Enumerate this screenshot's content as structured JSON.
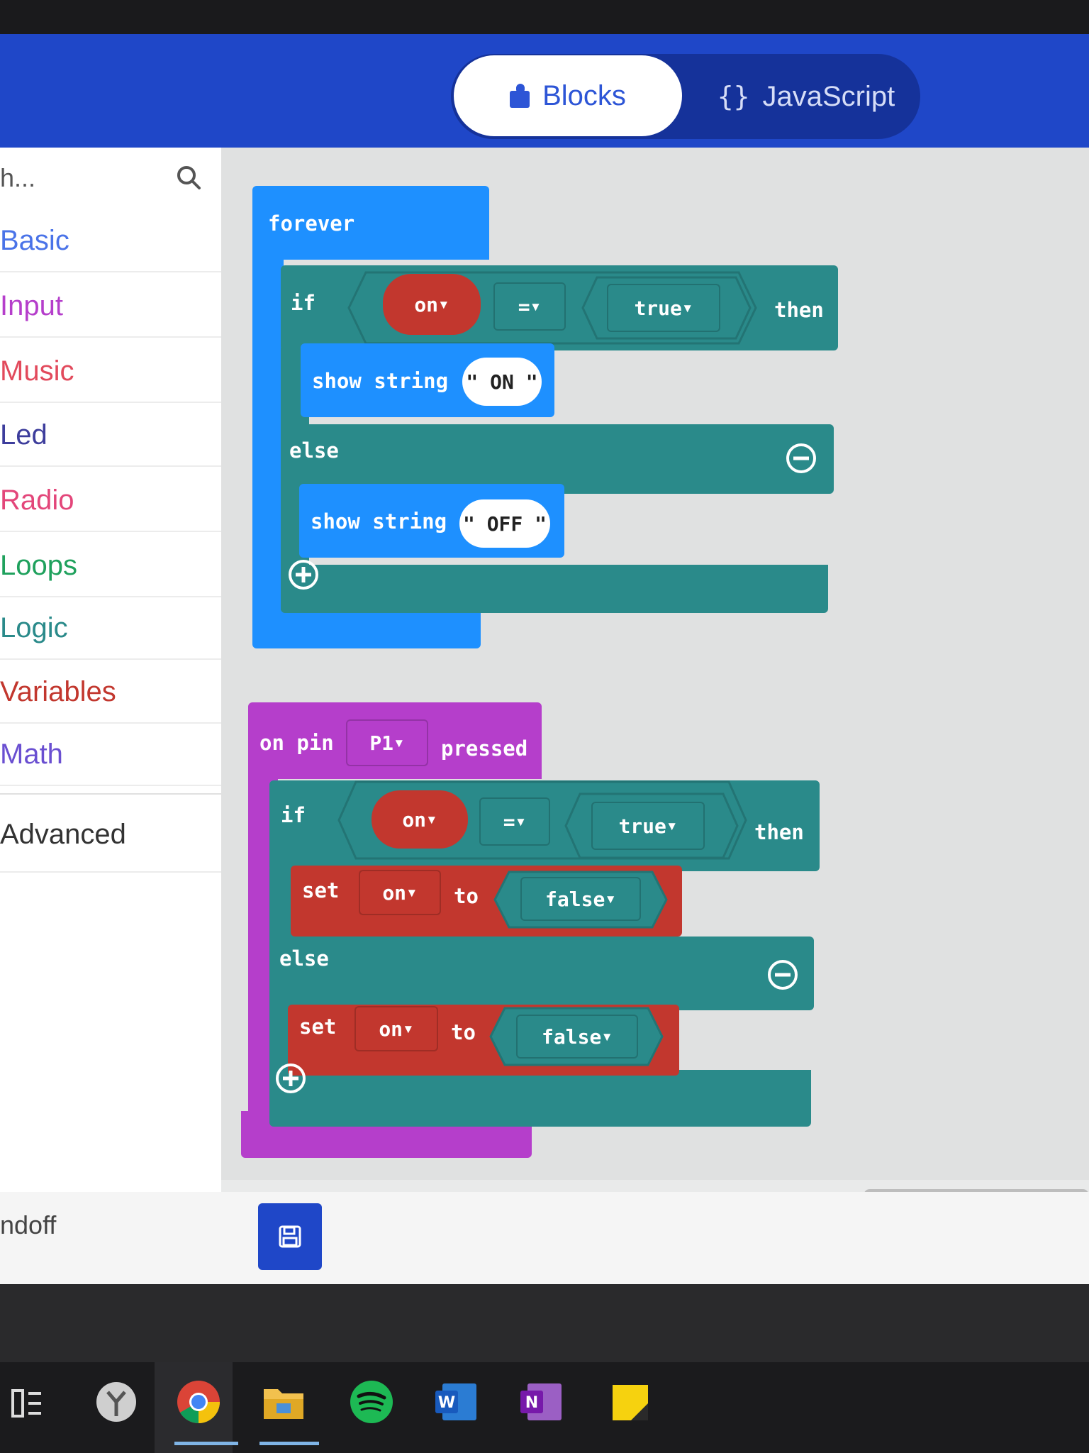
{
  "header": {
    "tab_blocks": "Blocks",
    "tab_javascript": "JavaScript",
    "tab_javascript_icon": "{}"
  },
  "sidebar": {
    "search_placeholder": "h...",
    "categories": [
      {
        "label": "Basic",
        "color": "#1e90ff"
      },
      {
        "label": "Input",
        "color": "#b53ecb"
      },
      {
        "label": "Music",
        "color": "#e24a5c"
      },
      {
        "label": "Led",
        "color": "#3d3d9c"
      },
      {
        "label": "Radio",
        "color": "#e3467a"
      },
      {
        "label": "Loops",
        "color": "#1fa15d"
      },
      {
        "label": "Logic",
        "color": "#2a8a8a"
      },
      {
        "label": "Variables",
        "color": "#c2372e"
      },
      {
        "label": "Math",
        "color": "#6a4fd1"
      }
    ],
    "advanced": "Advanced"
  },
  "blocks": {
    "forever": {
      "label": "forever",
      "if_label": "if",
      "cond_var": "on",
      "cond_op": "=",
      "cond_value": "true",
      "then_label": "then",
      "show1_label": "show string",
      "show1_value": "ON",
      "else_label": "else",
      "show2_label": "show string",
      "show2_value": "OFF"
    },
    "onpin": {
      "label_pre": "on pin",
      "pin": "P1",
      "label_post": "pressed",
      "if_label": "if",
      "cond_var": "on",
      "cond_op": "=",
      "cond_value": "true",
      "then_label": "then",
      "set1_label": "set",
      "set1_var": "on",
      "set1_to": "to",
      "set1_value": "false",
      "else_label": "else",
      "set2_label": "set",
      "set2_var": "on",
      "set2_to": "to",
      "set2_value": "false"
    }
  },
  "footer": {
    "project_name": "ndoff"
  },
  "colors": {
    "header": "#1f47c8",
    "basic": "#1e90ff",
    "logic": "#2a8a8a",
    "variables": "#c2372e",
    "input": "#b53ecb"
  },
  "taskbar": {
    "icons": [
      "task-view-icon",
      "clock-app-icon",
      "chrome-icon",
      "file-explorer-icon",
      "spotify-icon",
      "word-icon",
      "onenote-icon",
      "sticky-notes-icon"
    ]
  }
}
